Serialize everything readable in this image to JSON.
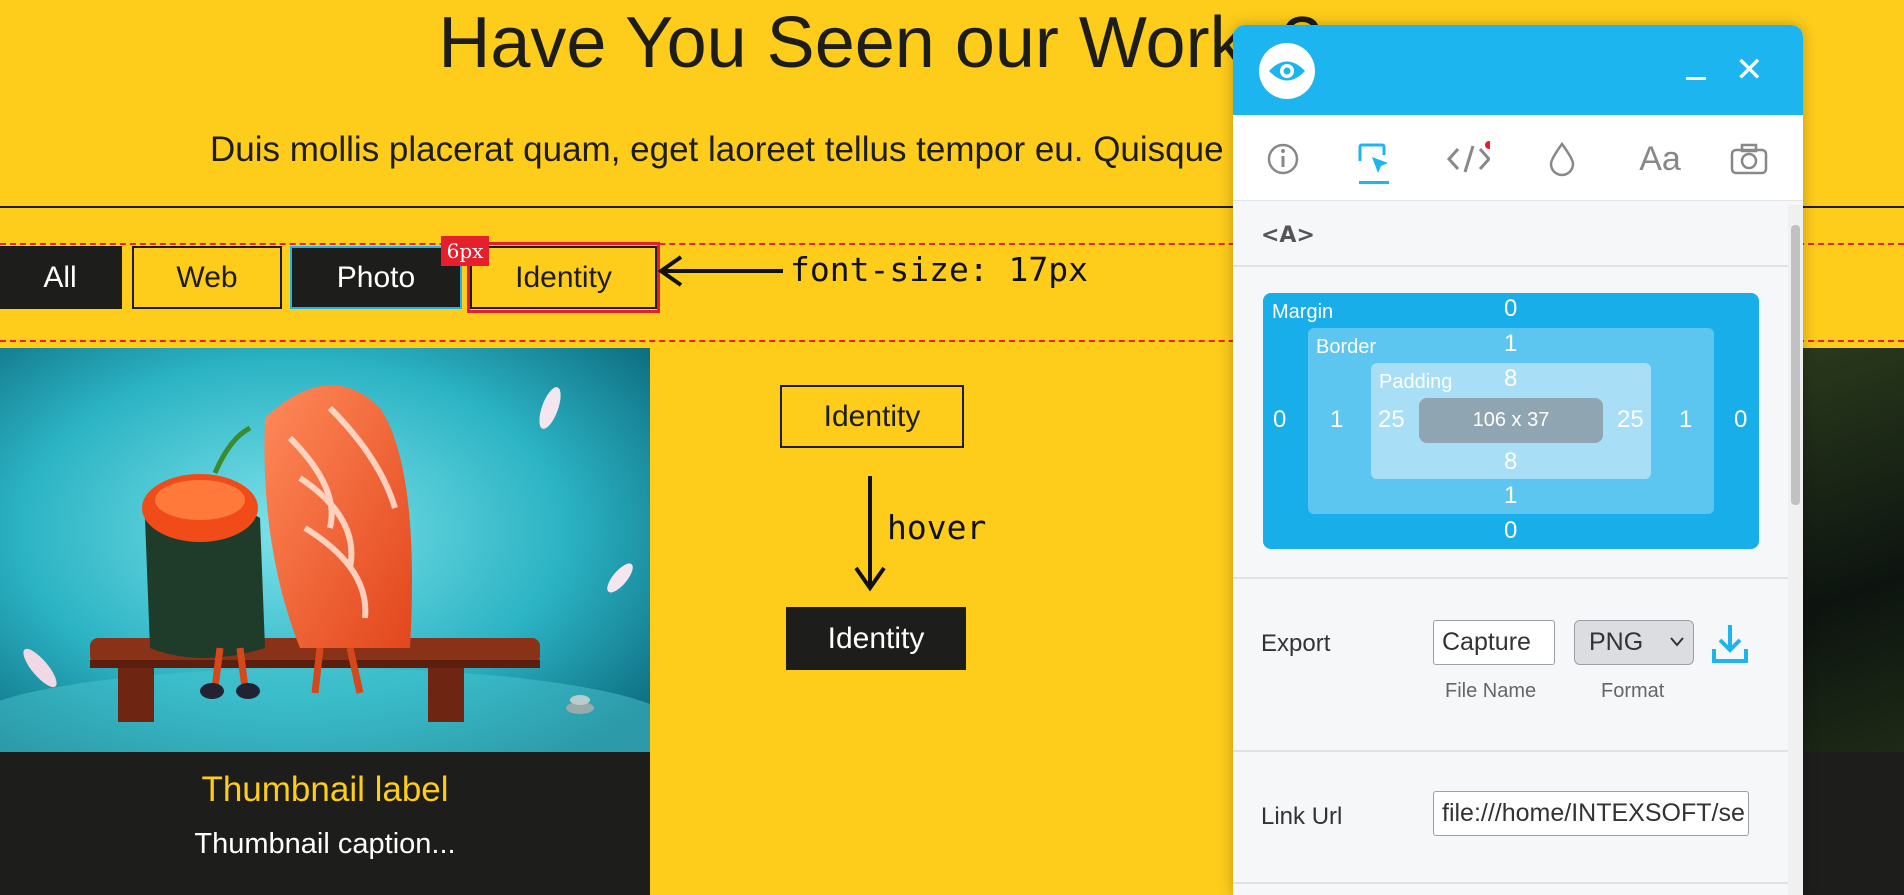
{
  "page": {
    "heading": "Have You Seen our Works?",
    "intro": "Duis mollis placerat quam, eget laoreet tellus tempor eu. Quisque",
    "filters": [
      "All",
      "Web",
      "Photo",
      "Identity"
    ],
    "spacing_badge": "6px",
    "annotation_font": "font-size: 17px",
    "demo_button": "Identity",
    "demo_hover_label": "hover",
    "demo_button_hover": "Identity",
    "thumbnail": {
      "label": "Thumbnail label",
      "caption": "Thumbnail caption..."
    }
  },
  "colors": {
    "yellow": "#fecc1b",
    "dark": "#1d1d1b",
    "accent": "#1db5ef",
    "red": "#e5202c"
  },
  "inspector": {
    "logo_icon": "eye-icon",
    "tabs": [
      "info-icon",
      "cursor-select-icon",
      "code-icon",
      "color-drop-icon",
      "font-icon",
      "camera-icon"
    ],
    "font_tab_label": "Aa",
    "element_tag": "<A>",
    "box_model": {
      "margin_label": "Margin",
      "border_label": "Border",
      "padding_label": "Padding",
      "margin": {
        "top": "0",
        "right": "0",
        "bottom": "0",
        "left": "0"
      },
      "border": {
        "top": "1",
        "right": "1",
        "bottom": "1",
        "left": "1"
      },
      "padding": {
        "top": "8",
        "right": "25",
        "bottom": "8",
        "left": "25"
      },
      "size": "106 x 37"
    },
    "export": {
      "label": "Export",
      "file_name": "Capture",
      "file_name_label": "File Name",
      "format": "PNG",
      "format_label": "Format"
    },
    "link": {
      "label": "Link Url",
      "value": "file:///home/INTEXSOFT/se"
    }
  }
}
